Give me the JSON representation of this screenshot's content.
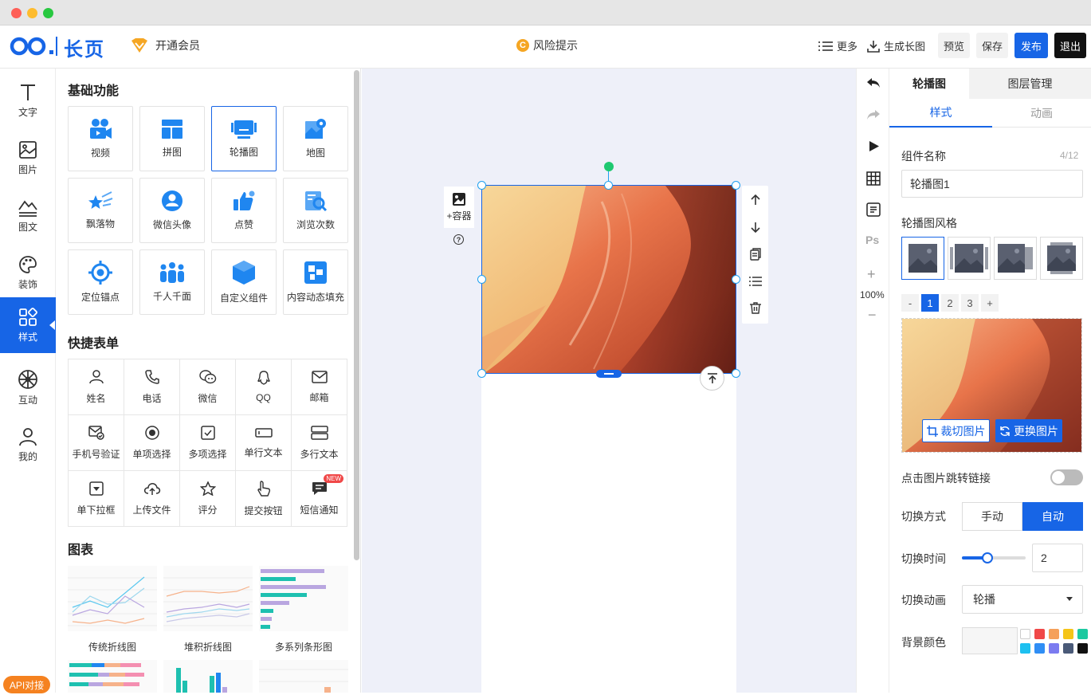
{
  "app": {
    "logo_text": "长页",
    "vip_label": "开通会员",
    "risk_label": "风险提示",
    "risk_icon_letter": "C"
  },
  "header": {
    "more": "更多",
    "long_image": "生成长图",
    "preview": "预览",
    "save": "保存",
    "publish": "发布",
    "exit": "退出"
  },
  "left_nav": [
    {
      "label": "文字",
      "icon": "text-icon"
    },
    {
      "label": "图片",
      "icon": "image-icon"
    },
    {
      "label": "图文",
      "icon": "image-text-icon"
    },
    {
      "label": "装饰",
      "icon": "palette-icon"
    },
    {
      "label": "样式",
      "icon": "style-icon",
      "active": true
    },
    {
      "label": "互动",
      "icon": "wheel-icon"
    },
    {
      "label": "我的",
      "icon": "user-icon"
    }
  ],
  "basic": {
    "title": "基础功能",
    "items": [
      "视频",
      "拼图",
      "轮播图",
      "地图",
      "飘落物",
      "微信头像",
      "点赞",
      "浏览次数",
      "定位锚点",
      "千人千面",
      "自定义组件",
      "内容动态填充"
    ]
  },
  "form": {
    "title": "快捷表单",
    "items": [
      "姓名",
      "电话",
      "微信",
      "QQ",
      "邮箱",
      "手机号验证",
      "单项选择",
      "多项选择",
      "单行文本",
      "多行文本",
      "单下拉框",
      "上传文件",
      "评分",
      "提交按钮",
      "短信通知"
    ],
    "new_badge": "NEW"
  },
  "charts": {
    "title": "图表",
    "items": [
      "传统折线图",
      "堆积折线图",
      "多系列条形图"
    ]
  },
  "api_badge": "API对接",
  "canvas": {
    "container_label": "+容器",
    "help": "?"
  },
  "right_tools": {
    "zoom": "100%",
    "plus": "+",
    "minus": "−",
    "ps": "Ps"
  },
  "panel": {
    "tabs": [
      "轮播图",
      "图层管理"
    ],
    "subtabs": [
      "样式",
      "动画"
    ],
    "name_label": "组件名称",
    "name_count": "4/12",
    "name_value": "轮播图1",
    "style_label": "轮播图风格",
    "pages": [
      "-",
      "1",
      "2",
      "3",
      "+"
    ],
    "crop": "裁切图片",
    "replace": "更换图片",
    "link_label": "点击图片跳转链接",
    "switch_label": "切换方式",
    "switch_options": [
      "手动",
      "自动"
    ],
    "time_label": "切换时间",
    "time_value": "2",
    "time_slider_fraction": 0.4,
    "anim_label": "切换动画",
    "anim_value": "轮播",
    "bg_label": "背景颜色"
  },
  "colors": {
    "accent": "#1765e6",
    "swatches": [
      "#ffffff",
      "#f04848",
      "#f5a05a",
      "#f5c518",
      "#1cc9a0",
      "#1ec0f0",
      "#2f8ef5",
      "#7b7bf0",
      "#4a5a78",
      "#111111"
    ]
  }
}
